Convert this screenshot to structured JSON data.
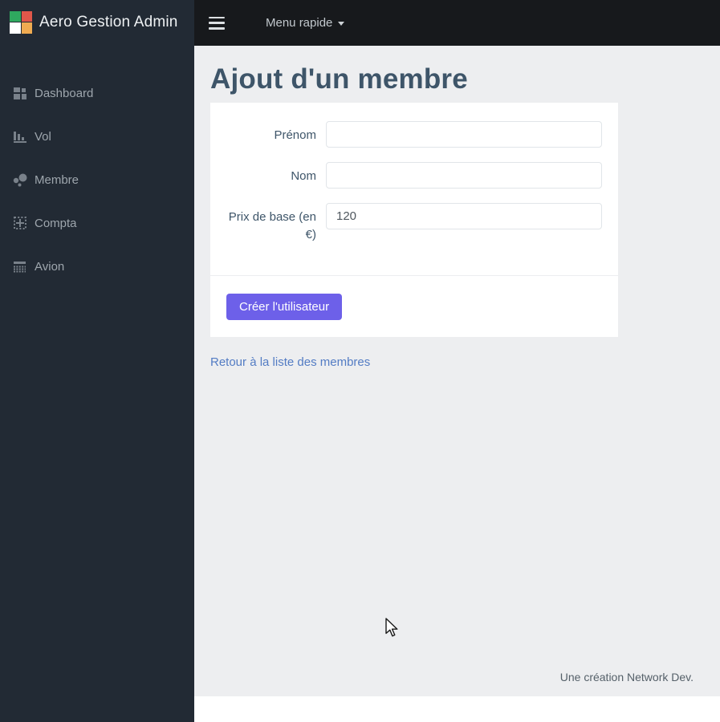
{
  "brand": {
    "title": "Aero Gestion Admin",
    "logo_colors": [
      "#2fa95f",
      "#e0574a",
      "#ffffff",
      "#f0ab51"
    ]
  },
  "topbar": {
    "menu_label": "Menu rapide"
  },
  "sidebar": {
    "items": [
      {
        "label": "Dashboard",
        "icon": "dashboard-icon"
      },
      {
        "label": "Vol",
        "icon": "bar-chart-icon"
      },
      {
        "label": "Membre",
        "icon": "people-icon"
      },
      {
        "label": "Compta",
        "icon": "spreadsheet-icon"
      },
      {
        "label": "Avion",
        "icon": "table-list-icon"
      }
    ]
  },
  "page": {
    "title": "Ajout d'un membre"
  },
  "form": {
    "fields": [
      {
        "label": "Prénom",
        "value": ""
      },
      {
        "label": "Nom",
        "value": ""
      },
      {
        "label": "Prix de base (en €)",
        "value": "120"
      }
    ],
    "submit_label": "Créer l'utilisateur"
  },
  "back_link": {
    "label": "Retour à la liste des membres"
  },
  "footer": {
    "credit": "Une création Network Dev."
  },
  "colors": {
    "accent": "#6d60e9",
    "link": "#537cc4",
    "sidebar_bg": "#222a34",
    "topbar_bg": "#17191c",
    "content_bg": "#edeef0",
    "heading": "#3e5569"
  }
}
